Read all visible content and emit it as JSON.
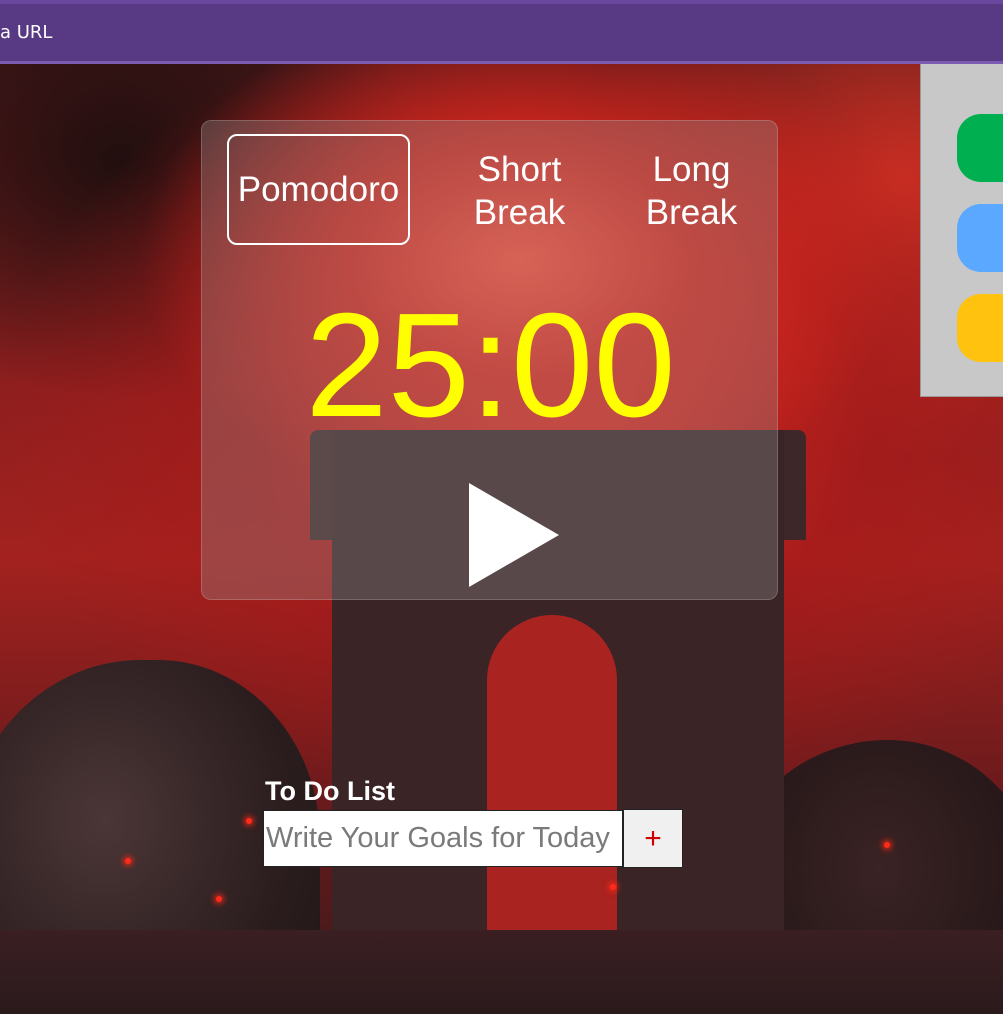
{
  "topbar": {
    "label": "a URL"
  },
  "timer": {
    "modes": {
      "pomodoro": "Pomodoro",
      "short_break": "Short Break",
      "long_break": "Long Break"
    },
    "active_mode": "pomodoro",
    "display": "25:00",
    "display_color": "#ffff00",
    "play_icon": "play-icon"
  },
  "side_panel": {
    "buttons": [
      {
        "color": "#00b050"
      },
      {
        "color": "#5aa8ff"
      },
      {
        "color": "#ffc20e"
      }
    ]
  },
  "todo": {
    "title": "To Do List",
    "input_placeholder": "Write Your Goals for Today",
    "input_value": "",
    "add_label": "+"
  }
}
